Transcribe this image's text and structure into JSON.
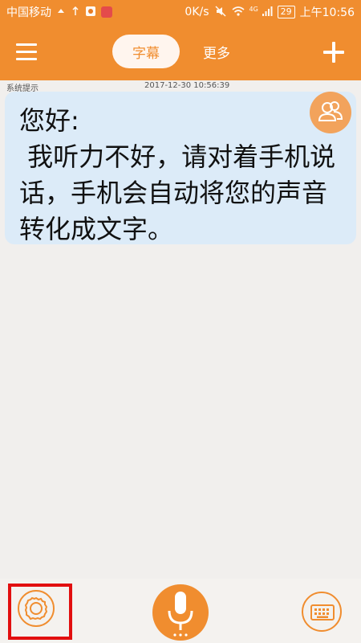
{
  "statusbar": {
    "carrier": "中国移动",
    "speed": "0K/s",
    "network": "4G",
    "battery": "29",
    "time": "上午10:56"
  },
  "navbar": {
    "tab_subtitle": "字幕",
    "tab_more": "更多"
  },
  "message": {
    "sender": "系统提示",
    "timestamp": "2017-12-30 10:56:39",
    "text": "您好:\n 我听力不好，请对着手机说话，手机会自动将您的声音转化成文字。"
  },
  "colors": {
    "accent": "#f08d2f",
    "bubble": "#dcebf8",
    "highlight": "#e20f0f"
  },
  "icons": {
    "menu": "menu-icon",
    "add": "plus-icon",
    "contacts": "contacts-icon",
    "settings": "gear-icon",
    "mic": "microphone-icon",
    "keyboard": "keyboard-icon"
  }
}
